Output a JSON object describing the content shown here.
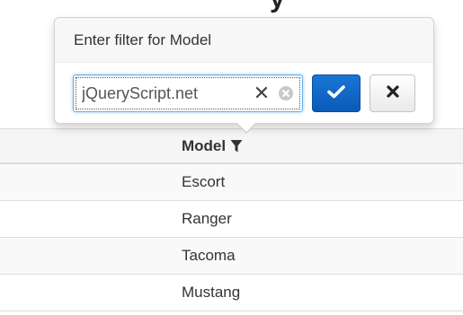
{
  "page": {
    "heading_fragment": "y"
  },
  "filter_popover": {
    "title": "Enter filter for Model",
    "input_value": "jQueryScript.net",
    "icons": {
      "clear_text": "close-x-icon",
      "clear_all": "circle-x-icon",
      "apply": "check-icon",
      "cancel": "close-icon"
    },
    "colors": {
      "apply_button": "#0d63c3",
      "input_focus_border": "#66afe9"
    }
  },
  "table": {
    "column_header": "Model",
    "column_filter_icon": "filter-icon",
    "rows": [
      {
        "model": "Escort"
      },
      {
        "model": "Ranger"
      },
      {
        "model": "Tacoma"
      },
      {
        "model": "Mustang"
      }
    ]
  }
}
